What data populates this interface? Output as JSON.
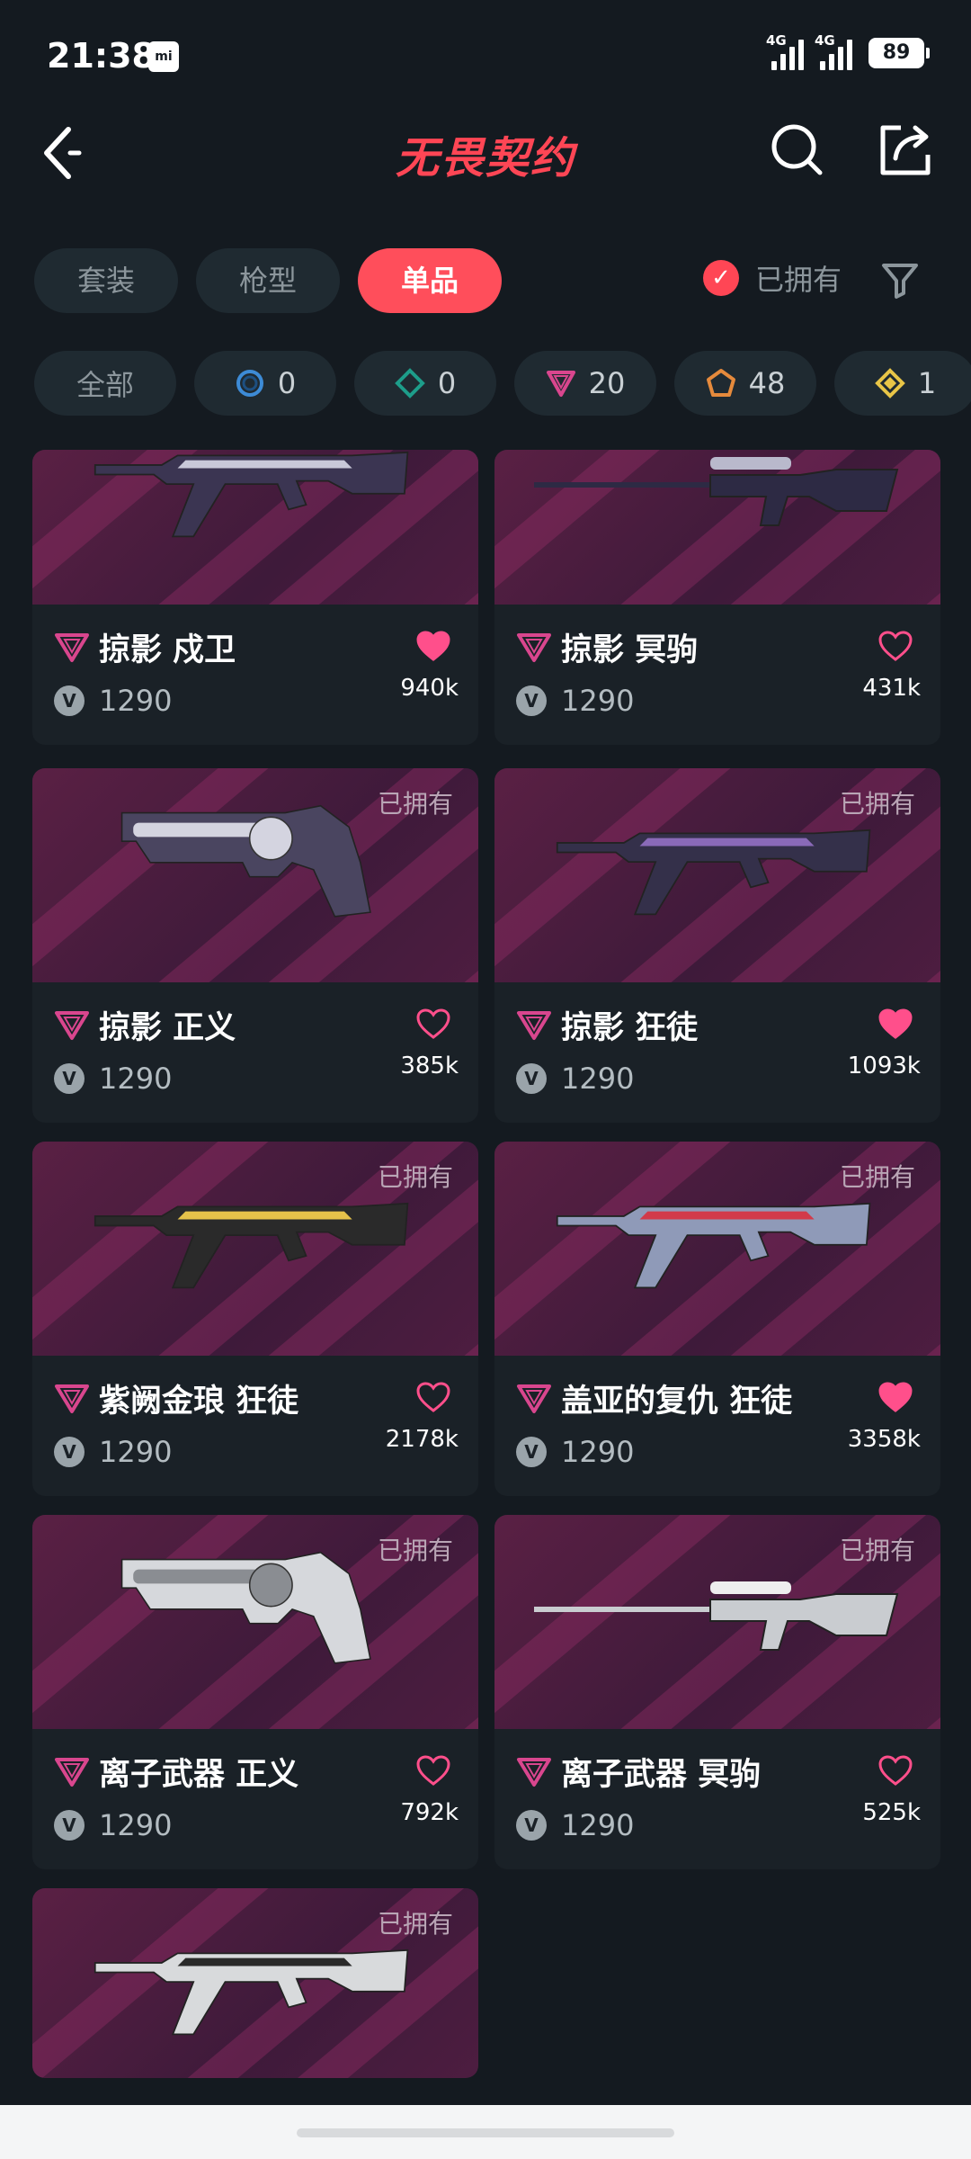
{
  "status": {
    "time": "21:38",
    "mi": "mi",
    "net1": "4G",
    "net2": "4G",
    "battery": "89"
  },
  "header": {
    "title": "无畏契约",
    "back_icon": "back-arrow-icon",
    "search_icon": "search-icon",
    "share_icon": "share-icon"
  },
  "type_tabs": [
    {
      "label": "套装"
    },
    {
      "label": "枪型"
    },
    {
      "label": "单品"
    }
  ],
  "owned_filter": {
    "label": "已拥有",
    "checked": true
  },
  "tiers": {
    "all": "全部",
    "t1": "0",
    "t2": "0",
    "t3": "20",
    "t4": "48",
    "t5": "1"
  },
  "owned_label": "已拥有",
  "items": [
    {
      "name": "掠影 戍卫",
      "price": "1290",
      "likes": "940k",
      "liked": true
    },
    {
      "name": "掠影 冥驹",
      "price": "1290",
      "likes": "431k",
      "liked": false
    },
    {
      "name": "掠影 正义",
      "price": "1290",
      "likes": "385k",
      "liked": false
    },
    {
      "name": "掠影 狂徒",
      "price": "1290",
      "likes": "1093k",
      "liked": true
    },
    {
      "name": "紫阙金琅 狂徒",
      "price": "1290",
      "likes": "2178k",
      "liked": false
    },
    {
      "name": "盖亚的复仇 狂徒",
      "price": "1290",
      "likes": "3358k",
      "liked": true
    },
    {
      "name": "离子武器 正义",
      "price": "1290",
      "likes": "792k",
      "liked": false
    },
    {
      "name": "离子武器 冥驹",
      "price": "1290",
      "likes": "525k",
      "liked": false
    },
    {
      "name": "",
      "price": "",
      "likes": "",
      "liked": false
    }
  ],
  "colors": {
    "accent": "#ff4655",
    "heart": "#ff4f8b",
    "bg": "#141a20",
    "card": "#1a2127"
  }
}
